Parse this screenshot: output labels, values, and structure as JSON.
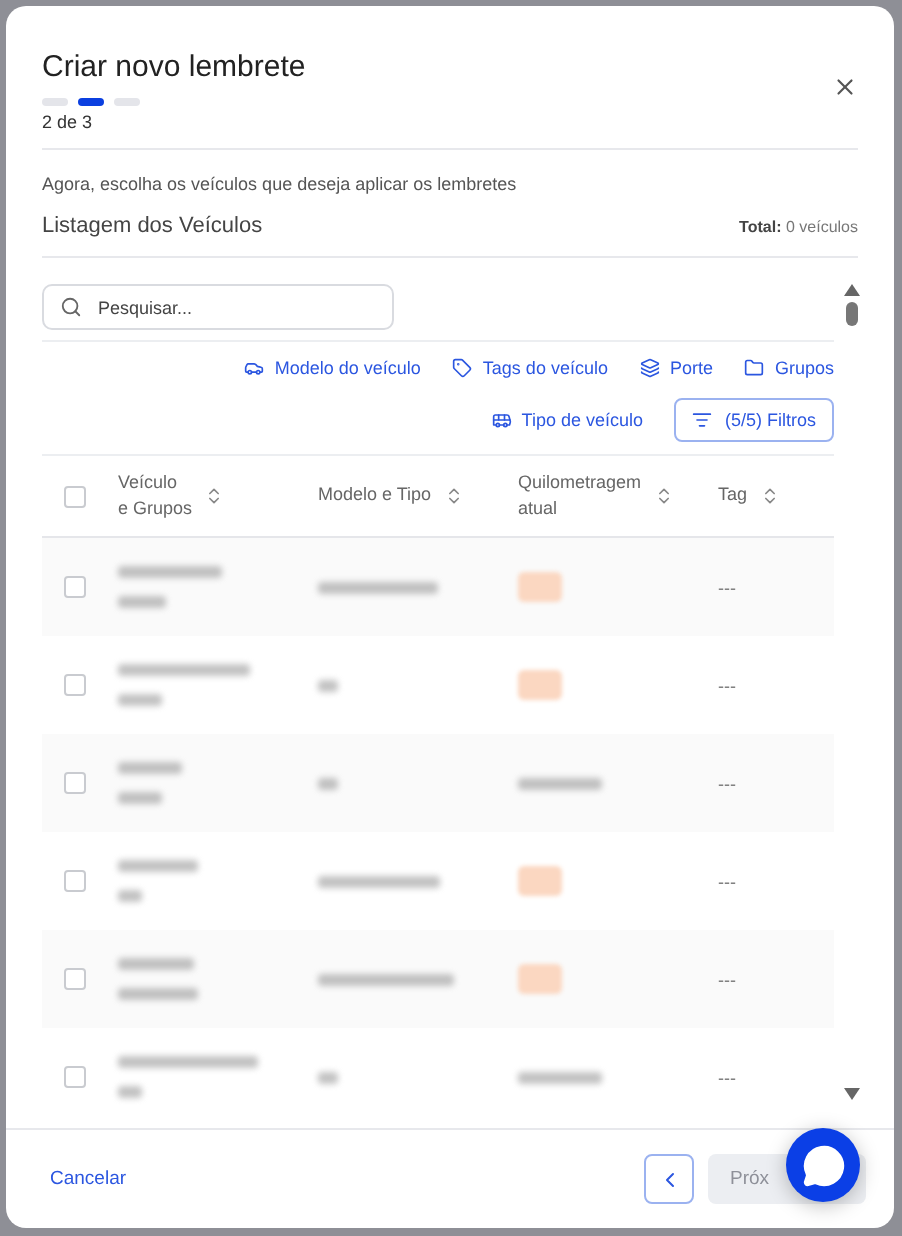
{
  "dialog": {
    "title": "Criar novo lembrete",
    "steps": [
      {
        "selected": false
      },
      {
        "selected": true
      },
      {
        "selected": false
      }
    ],
    "step_label": "2 de 3"
  },
  "instruction": "Agora, escolha os veículos que deseja aplicar os lembretes",
  "list": {
    "title": "Listagem dos Veículos",
    "total_label": "Total:",
    "total_value": "0 veículos"
  },
  "search": {
    "placeholder": "Pesquisar..."
  },
  "filters": [
    {
      "label": "Modelo do veículo",
      "kind": "car"
    },
    {
      "label": "Tags do veículo",
      "kind": "tag"
    },
    {
      "label": "Porte",
      "kind": "stack"
    },
    {
      "label": "Grupos",
      "kind": "folder"
    },
    {
      "label": "Tipo de veículo",
      "kind": "vehicle"
    }
  ],
  "filter_button": "(5/5) Filtros",
  "table": {
    "header_checked": false,
    "columns": [
      {
        "lines": [
          "Veículo",
          "e Grupos"
        ]
      },
      {
        "lines": [
          "Modelo e Tipo"
        ]
      },
      {
        "lines": [
          "Quilometragem",
          "atual"
        ]
      },
      {
        "lines": [
          "Tag"
        ]
      }
    ],
    "rows": [
      {
        "checked": false,
        "model": {
          "kind": "long"
        },
        "mileage": {
          "kind": "badge"
        },
        "tag": "---"
      },
      {
        "checked": false,
        "model": {
          "kind": "short"
        },
        "mileage": {
          "kind": "badge"
        },
        "tag": "---"
      },
      {
        "checked": false,
        "model": {
          "kind": "short"
        },
        "mileage": {
          "kind": "number"
        },
        "tag": "---"
      },
      {
        "checked": false,
        "model": {
          "kind": "long"
        },
        "mileage": {
          "kind": "badge"
        },
        "tag": "---"
      },
      {
        "checked": false,
        "model": {
          "kind": "long"
        },
        "mileage": {
          "kind": "badge"
        },
        "tag": "---"
      },
      {
        "checked": false,
        "model": {
          "kind": "short"
        },
        "mileage": {
          "kind": "number"
        },
        "tag": "---"
      }
    ]
  },
  "footer": {
    "cancel": "Cancelar",
    "next": "Próx"
  }
}
